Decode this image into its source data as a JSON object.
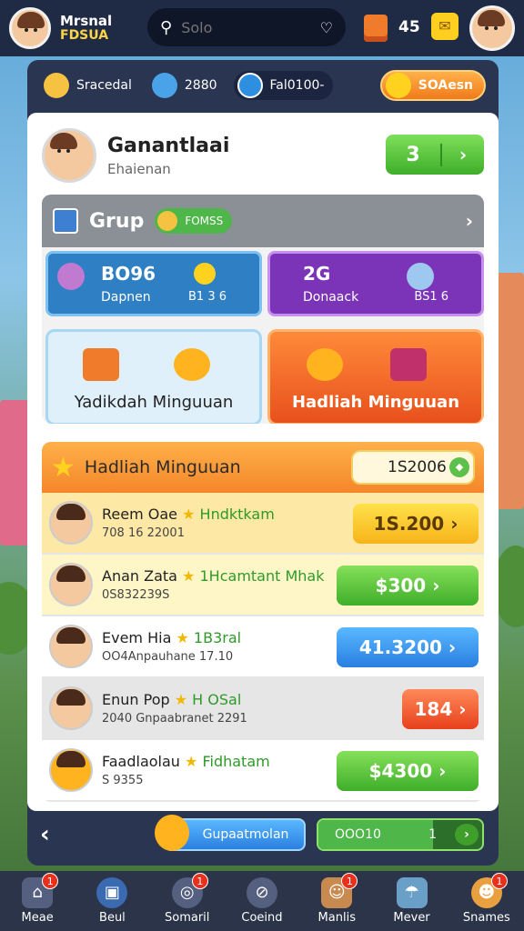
{
  "top": {
    "name_line1": "Mrsnal",
    "name_line2": "FDSUA",
    "search_placeholder": "Solo",
    "count": "45"
  },
  "resources": {
    "r1": "Sracedal",
    "r2": "2880",
    "r3": "Fal0100-",
    "button": "SOAesn"
  },
  "profile": {
    "name": "Ganantlaai",
    "sub": "Ehaienan",
    "level": "3"
  },
  "group": {
    "title": "Grup",
    "pill": "FOMSS",
    "stat_blue": {
      "big": "BO96",
      "small": "Dapnen",
      "right": "B1 3 6"
    },
    "stat_purple": {
      "big": "2G",
      "small": "Donaack",
      "right": "BS1 6"
    },
    "reward_left": "Yadikdah Minguuan",
    "reward_right": "Hadliah Minguuan"
  },
  "list": {
    "title": "Hadliah Minguuan",
    "pill": "1S2006",
    "rows": [
      {
        "name": "Reem Oae",
        "tag": "Hndktkam",
        "sub": "708 16 22001",
        "btn": "1S.200"
      },
      {
        "name": "Anan Zata",
        "tag": "1Hcamtant Mhak",
        "sub": "0S832239S",
        "btn": "$300"
      },
      {
        "name": "Evem Hia",
        "tag": "1B3ral",
        "sub": "OO4Anpauhane 17.10",
        "btn": "41.3200"
      },
      {
        "name": "Enun Pop",
        "tag": "H OSal",
        "sub": "2040 Gnpaabranet 2291",
        "btn": "184"
      },
      {
        "name": "Faadlaolau",
        "tag": "Fidhatam",
        "sub": "S 9355",
        "btn": "$4300"
      }
    ]
  },
  "bottom": {
    "button": "Gupaatmolan",
    "progress_left": "OOO10",
    "progress_right": "1",
    "progress_fraction": 0.7
  },
  "nav": [
    {
      "label": "Meae",
      "badge": "1"
    },
    {
      "label": "Beul",
      "badge": ""
    },
    {
      "label": "Somaril",
      "badge": "1"
    },
    {
      "label": "Coeind",
      "badge": ""
    },
    {
      "label": "Manlis",
      "badge": "1"
    },
    {
      "label": "Mever",
      "badge": ""
    },
    {
      "label": "Snames",
      "badge": "1"
    }
  ]
}
